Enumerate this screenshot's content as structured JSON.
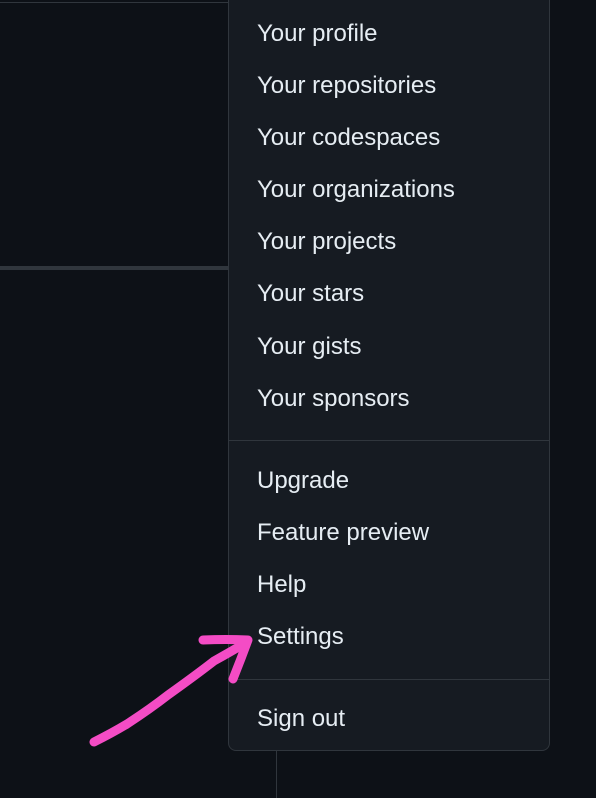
{
  "menu": {
    "section1": [
      "Your profile",
      "Your repositories",
      "Your codespaces",
      "Your organizations",
      "Your projects",
      "Your stars",
      "Your gists",
      "Your sponsors"
    ],
    "section2": [
      "Upgrade",
      "Feature preview",
      "Help",
      "Settings"
    ],
    "section3": [
      "Sign out"
    ]
  },
  "colors": {
    "background": "#0d1117",
    "menu_background": "#161b22",
    "border": "#30363d",
    "text": "#e6edf3",
    "annotation": "#f44cc5"
  },
  "annotation": {
    "type": "hand-drawn-arrow",
    "points_to": "Settings"
  }
}
